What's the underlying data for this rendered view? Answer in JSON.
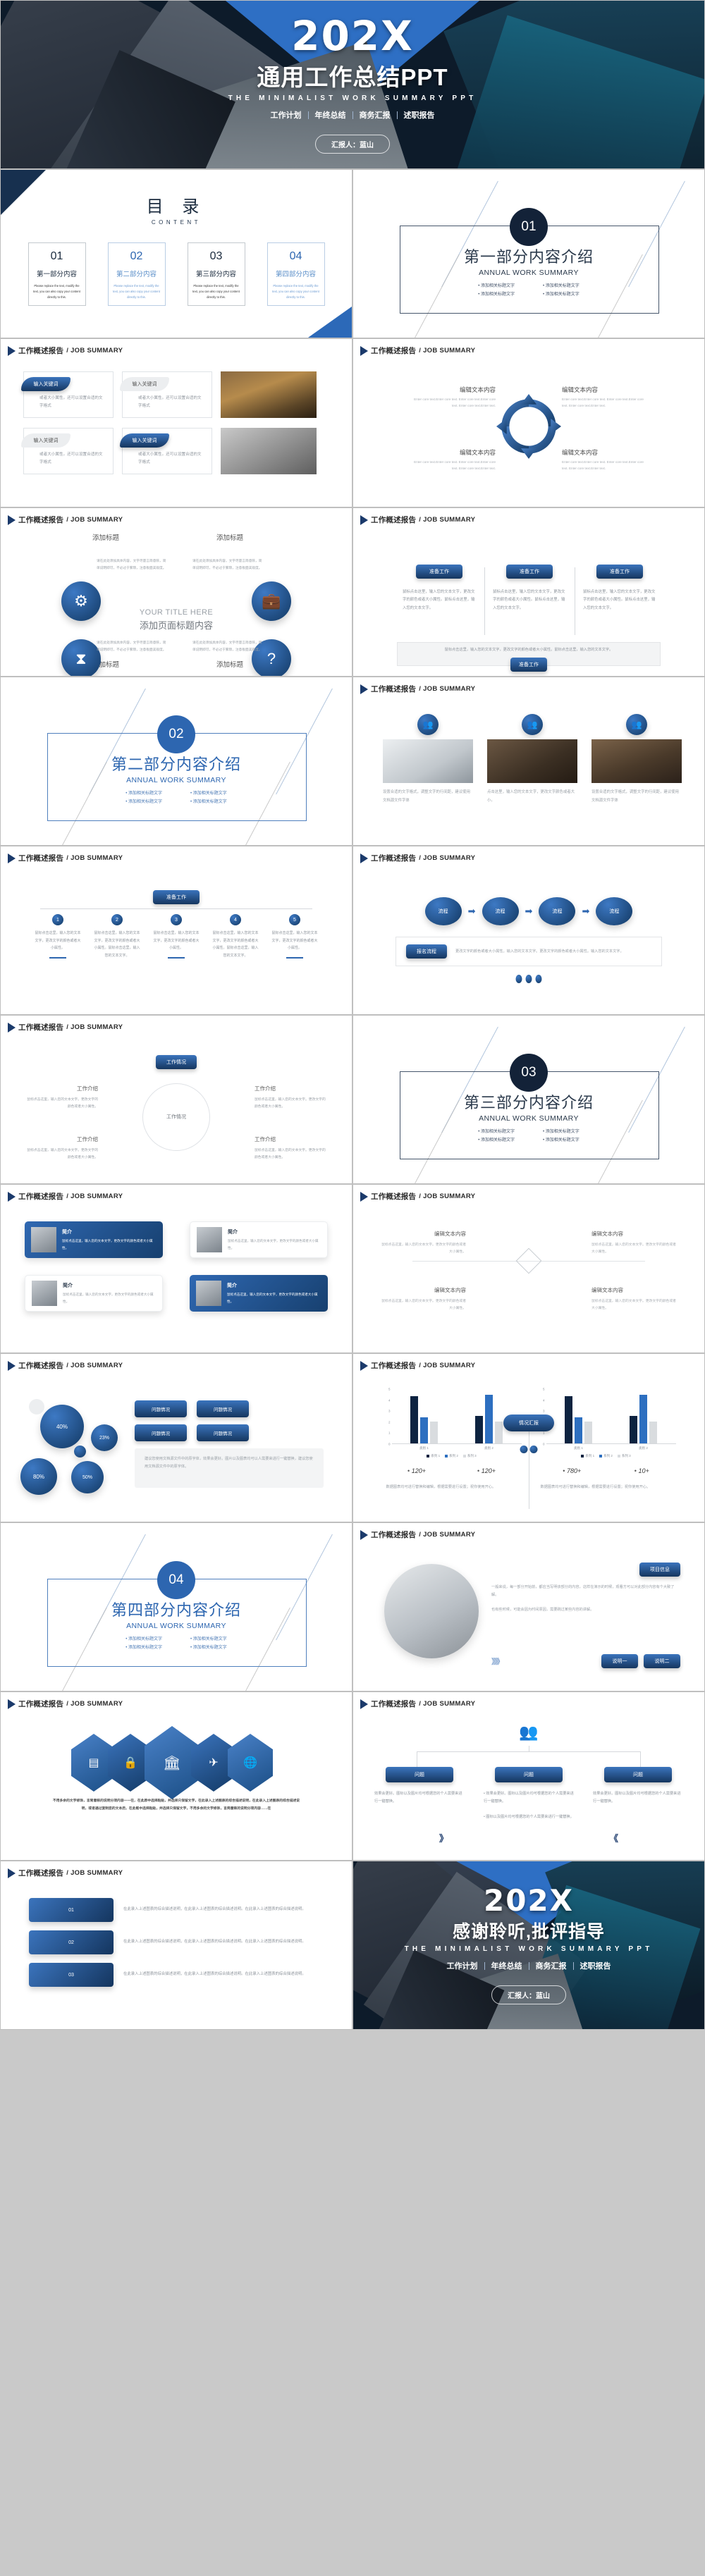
{
  "cover": {
    "year": "202X",
    "title": "通用工作总结PPT",
    "subtitle": "THE MINIMALIST WORK SUMMARY PPT",
    "tags": [
      "工作计划",
      "年终总结",
      "商务汇报",
      "述职报告"
    ],
    "presenter": "汇报人：蓝山"
  },
  "thanks": {
    "year": "202X",
    "title": "感谢聆听,批评指导",
    "subtitle": "THE MINIMALIST WORK SUMMARY PPT",
    "tags": [
      "工作计划",
      "年终总结",
      "商务汇报",
      "述职报告"
    ],
    "presenter": "汇报人：蓝山"
  },
  "header": {
    "cn": "工作概述报告",
    "en": "/ JOB SUMMARY"
  },
  "toc": {
    "title_cn": "目 录",
    "title_en": "CONTENT",
    "items": [
      {
        "num": "01",
        "title": "第一部分内容",
        "desc": "Please replace the text, modify the text, you can also copy your content directly to this."
      },
      {
        "num": "02",
        "title": "第二部分内容",
        "desc": "Please replace the text, modify the text, you can also copy your content directly to this."
      },
      {
        "num": "03",
        "title": "第三部分内容",
        "desc": "Please replace the text, modify the text, you can also copy your content directly to this."
      },
      {
        "num": "04",
        "title": "第四部分内容",
        "desc": "Please replace the text, modify the text, you can also copy your content directly to this."
      }
    ]
  },
  "sections": [
    {
      "num": "01",
      "cn": "第一部分内容介绍",
      "en": "ANNUAL WORK SUMMARY",
      "bullets": [
        "添加相关标题文字",
        "添加相关标题文字",
        "添加相关标题文字",
        "添加相关标题文字"
      ]
    },
    {
      "num": "02",
      "cn": "第二部分内容介绍",
      "en": "ANNUAL WORK SUMMARY",
      "bullets": [
        "添加相关标题文字",
        "添加相关标题文字",
        "添加相关标题文字",
        "添加相关标题文字"
      ]
    },
    {
      "num": "03",
      "cn": "第三部分内容介绍",
      "en": "ANNUAL WORK SUMMARY",
      "bullets": [
        "添加相关标题文字",
        "添加相关标题文字",
        "添加相关标题文字",
        "添加相关标题文字"
      ]
    },
    {
      "num": "04",
      "cn": "第四部分内容介绍",
      "en": "ANNUAL WORK SUMMARY",
      "bullets": [
        "添加相关标题文字",
        "添加相关标题文字",
        "添加相关标题文字",
        "添加相关标题文字"
      ]
    }
  ],
  "keyword_slide": {
    "cards": [
      {
        "tag": "输入关键词",
        "text": "或者大小属性。还可以设置合适的文字格式"
      },
      {
        "tag": "输入关键词",
        "text": "或者大小属性。还可以设置合适的文字格式"
      },
      {
        "tag": "输入关键词",
        "text": "或者大小属性。还可以设置合适的文字格式"
      },
      {
        "tag": "输入关键词",
        "text": "或者大小属性。还可以设置合适的文字格式"
      }
    ]
  },
  "cycle_slide": {
    "labels": [
      {
        "title": "编辑文本内容",
        "desc": "Enter core text.Enter core text. Enter core text.Enter core text. Enter core text.Enter text."
      },
      {
        "title": "编辑文本内容",
        "desc": "Enter core text.Enter core text. Enter core text.Enter core text. Enter core text.Enter text."
      },
      {
        "title": "编辑文本内容",
        "desc": "Enter core text.Enter core text. Enter core text.Enter core text. Enter core text.Enter text."
      },
      {
        "title": "编辑文本内容",
        "desc": "Enter core text.Enter core text. Enter core text.Enter core text. Enter core text.Enter text."
      }
    ]
  },
  "icons_slide": {
    "center_en": "YOUR TITLE HERE",
    "center_cn": "添加页面标题内容",
    "top_titles": [
      "添加标题",
      "添加标题"
    ],
    "bottom_titles": [
      "添加标题",
      "添加标题"
    ],
    "body": "请在此处添加具体内容，文字尽量言简意赅，简单说明即可，不必过于繁琐，注意板面美观度。",
    "icons": [
      "gears-icon",
      "briefcase-icon",
      "hourglass-icon",
      "question-icon"
    ]
  },
  "three_col_slide": {
    "columns": [
      {
        "tag": "准备工作",
        "text": "鼠标点击这里，输入您的文本文字，更改文字的颜色或者大小属性。鼠标点击这里，输入您的文本文字。"
      },
      {
        "tag": "准备工作",
        "text": "鼠标点击这里，输入您的文本文字，更改文字的颜色或者大小属性。鼠标点击这里，输入您的文本文字。"
      },
      {
        "tag": "准备工作",
        "text": "鼠标点击这里，输入您的文本文字，更改文字的颜色或者大小属性。鼠标点击这里，输入您的文本文字。"
      }
    ],
    "note": "鼠标点击这里，输入您的文本文字，更改文字的颜色或者大小属性。鼠标点击这里，输入您的文本文字。",
    "note_pill": "准备工作"
  },
  "photo_slide": {
    "cells": [
      {
        "icon": "users-icon",
        "caption": "设置合适的文字格式，调整文字的行间距，建议使用文档源文件字体"
      },
      {
        "icon": "users-icon",
        "caption": "点击这里，输入您的文本文字，更改文字颜色或者大小。"
      },
      {
        "icon": "users-icon",
        "caption": "设置合适的文字格式，调整文字的行间距，建议使用文档源文件字体"
      }
    ]
  },
  "tree_slide": {
    "top_pill": "准备工作",
    "nodes": [
      {
        "num": "1",
        "text": "鼠标点击这里，输入您的文本文字，更改文字的颜色或者大小属性。"
      },
      {
        "num": "2",
        "text": "鼠标点击这里，输入您的文本文字，更改文字的颜色或者大小属性。鼠标点击这里，输入您的文本文字。"
      },
      {
        "num": "3",
        "text": "鼠标点击这里，输入您的文本文字，更改文字的颜色或者大小属性。"
      },
      {
        "num": "4",
        "text": "鼠标点击这里，输入您的文本文字，更改文字的颜色或者大小属性。鼠标点击这里，输入您的文本文字。"
      },
      {
        "num": "5",
        "text": "鼠标点击这里，输入您的文本文字，更改文字的颜色或者大小属性。"
      }
    ]
  },
  "process_slide": {
    "steps": [
      "流程",
      "流程",
      "流程",
      "流程"
    ],
    "arrow": "➡",
    "box_pill": "报名流程",
    "box_text": "更改文字的颜色或者大小属性。输入您的文本文字。更改文字的颜色或者大小属性。输入您的文本文字。"
  },
  "radial_slide": {
    "top_pill": "工作情况",
    "center": "工作情况",
    "labels": [
      {
        "h": "工作介绍",
        "d": "鼠标点击这里，输入您的文本文字。更改文字的颜色或者大小属性。"
      },
      {
        "h": "工作介绍",
        "d": "鼠标点击这里，输入您的文本文字。更改文字的颜色或者大小属性。"
      },
      {
        "h": "工作介绍",
        "d": "鼠标点击这里，输入您的文本文字。更改文字的颜色或者大小属性。"
      },
      {
        "h": "工作介绍",
        "d": "鼠标点击这里，输入您的文本文字。更改文字的颜色或者大小属性。"
      }
    ]
  },
  "profile_slide": {
    "cards": [
      {
        "name": "简介",
        "desc": "鼠标点击这里，输入您的文本文字，更改文字的颜色或者大小属性。"
      },
      {
        "name": "简介",
        "desc": "鼠标点击这里，输入您的文本文字，更改文字的颜色或者大小属性。"
      },
      {
        "name": "简介",
        "desc": "鼠标点击这里，输入您的文本文字，更改文字的颜色或者大小属性。"
      },
      {
        "name": "简介",
        "desc": "鼠标点击这里，输入您的文本文字，更改文字的颜色或者大小属性。"
      }
    ]
  },
  "compass_slide": {
    "labels": [
      {
        "h": "编辑文本内容",
        "d": "鼠标点击这里，输入您的文本文字。更改文字的颜色或者大小属性。"
      },
      {
        "h": "编辑文本内容",
        "d": "鼠标点击这里，输入您的文本文字。更改文字的颜色或者大小属性。"
      },
      {
        "h": "编辑文本内容",
        "d": "鼠标点击这里，输入您的文本文字。更改文字的颜色或者大小属性。"
      },
      {
        "h": "编辑文本内容",
        "d": "鼠标点击这里，输入您的文本文字。更改文字的颜色或者大小属性。"
      }
    ]
  },
  "bubble_slide": {
    "bubbles": [
      {
        "label": "40%",
        "size": 62
      },
      {
        "label": "23%",
        "size": 38
      },
      {
        "label": "80%",
        "size": 52
      },
      {
        "label": "50%",
        "size": 46
      },
      {
        "label": "",
        "size": 17
      }
    ],
    "pills": [
      "问题情况",
      "问题情况",
      "问题情况",
      "问题情况"
    ],
    "note": "建议您使用文档源文件中的原字体，效果会更好。图片以及图表均可以人需要来进行一键替换，建议您使用文档源文件中的原字体。"
  },
  "chart_data": [
    {
      "type": "bar",
      "title": "",
      "categories": [
        "类别 1",
        "类别 2"
      ],
      "series": [
        {
          "name": "系列 1",
          "values": [
            4.3,
            2.5
          ],
          "color": "#0d2340"
        },
        {
          "name": "系列 2",
          "values": [
            2.4,
            4.4
          ],
          "color": "#2d6fc0"
        },
        {
          "name": "系列 3",
          "values": [
            2.0,
            2.0
          ],
          "color": "#d9dcdf"
        }
      ],
      "yticks": [
        "5",
        "4",
        "3",
        "2",
        "1",
        "0"
      ],
      "ylim": [
        0,
        5
      ],
      "legend": "bottom",
      "grid": false,
      "stats": [
        "120+",
        "120+"
      ],
      "note": "数据图表均可进行替换和编辑，根据需要进行设置；祝你使用开心。"
    },
    {
      "type": "bar",
      "title": "",
      "categories": [
        "类别 1",
        "类别 2"
      ],
      "series": [
        {
          "name": "系列 1",
          "values": [
            4.3,
            2.5
          ],
          "color": "#0d2340"
        },
        {
          "name": "系列 2",
          "values": [
            2.4,
            4.4
          ],
          "color": "#2d6fc0"
        },
        {
          "name": "系列 3",
          "values": [
            2.0,
            2.0
          ],
          "color": "#d9dcdf"
        }
      ],
      "yticks": [
        "5",
        "4",
        "3",
        "2",
        "1",
        "0"
      ],
      "ylim": [
        0,
        5
      ],
      "legend": "bottom",
      "grid": false,
      "stats": [
        "780+",
        "10+"
      ],
      "note": "数据图表均可进行替换和编辑，根据需要进行设置；祝你使用开心。"
    }
  ],
  "chart_slide": {
    "center_pill": "情况汇报",
    "top_label": "情况汇报"
  },
  "laptop_slide": {
    "pill": "项目信息",
    "rows": [
      "一般来说，每一部分开始前，都应当写明该部分的内容，这样在演示的时候，观看方可以对此部分内容有个大致了解。",
      "也有些时候，可能会因为时间原因，需要跳过某些内容的讲解。"
    ],
    "buttons": [
      "说明一",
      "说明二"
    ],
    "arrows": "》》》"
  },
  "hex_slide": {
    "icons": [
      "calendar-icon",
      "lock-icon",
      "bank-icon",
      "plane-icon",
      "globe-icon"
    ],
    "note": "不用多余的文字修饰，言简意赅的说明分项内容一一在，在此原中选择粘贴，并选择只保留文字，在此录入上述图表的综合描述说明，在此录入上述图表的综合描述说明，或者通过复制您的文本后，在此框中选择粘贴，并选择只保留文字，不用多余的文字修饰，言简意赅的说明分项内容……在"
  },
  "org_slide": {
    "top_icon": "users-icon",
    "columns": [
      {
        "pill": "问题",
        "lines": [
          "效果会更好。图标以及图片均可根据您的个人需要来进行一键替换。"
        ]
      },
      {
        "pill": "问题",
        "lines": [
          "效果会更好。图标以及图片均可根据您的个人需要来进行一键替换。",
          "图标以及图片均可根据您的个人需要来进行一键替换。"
        ]
      },
      {
        "pill": "问题",
        "lines": [
          "效果会更好。图标以及图片均可根据您的个人需要来进行一键替换。"
        ]
      }
    ],
    "chev_left": "》",
    "chev_right": "《"
  },
  "numbered_slide": {
    "rows": [
      {
        "tag": "01",
        "text": "在此录入上述图表的综合描述说明，在此录入上述图表的综合描述说明。在此录入上述图表的综合描述说明。"
      },
      {
        "tag": "02",
        "text": "在此录入上述图表的综合描述说明，在此录入上述图表的综合描述说明。在此录入上述图表的综合描述说明。"
      },
      {
        "tag": "03",
        "text": "在此录入上述图表的综合描述说明，在此录入上述图表的综合描述说明。在此录入上述图表的综合描述说明。"
      }
    ]
  },
  "colors": {
    "accent": "#2d66b0",
    "dark": "#132238",
    "series1": "#0d2340",
    "series2": "#2d6fc0",
    "series3": "#d9dcdf"
  }
}
